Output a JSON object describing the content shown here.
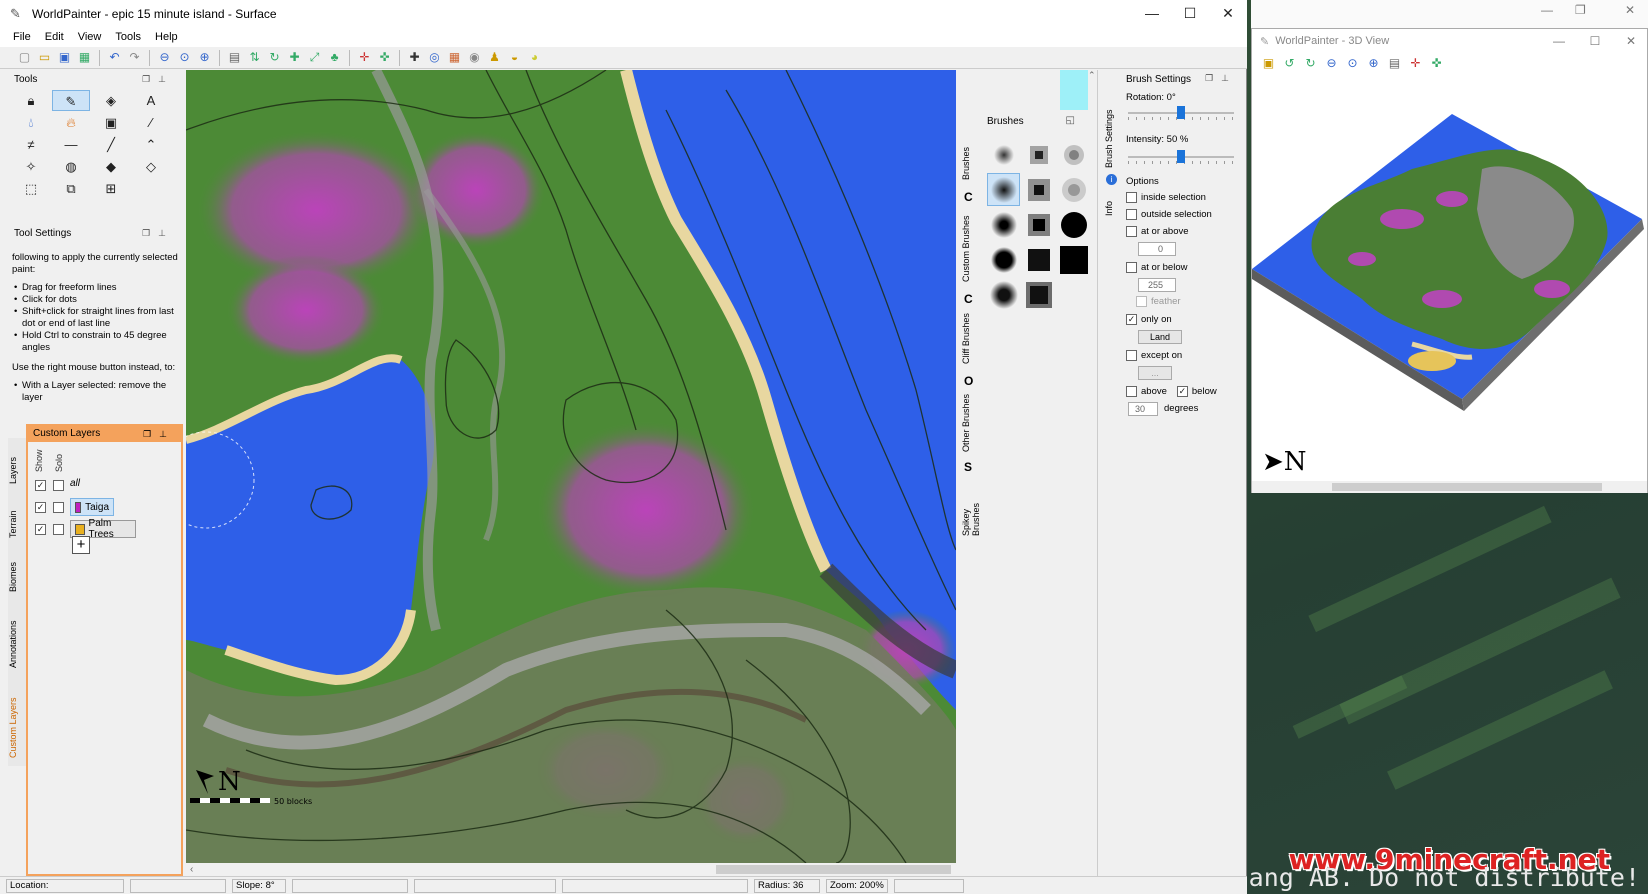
{
  "window": {
    "title": "WorldPainter - epic 15 minute island - Surface",
    "controls": {
      "minimize": "—",
      "maximize": "☐",
      "close": "✕"
    }
  },
  "menu": [
    "File",
    "Edit",
    "View",
    "Tools",
    "Help"
  ],
  "panels": {
    "tools_title": "Tools",
    "tool_settings_title": "Tool Settings",
    "custom_layers_title": "Custom Layers"
  },
  "tool_settings": {
    "intro": "following to apply the currently selected paint:",
    "items": [
      "Drag for freeform lines",
      "Click for dots",
      "Shift+click for straight lines from last dot or end of last line",
      "Hold Ctrl to constrain to 45 degree angles"
    ],
    "right_intro": "Use the right mouse button instead, to:",
    "right_items": [
      "With a Layer selected: remove the layer"
    ]
  },
  "left_tabs": [
    "Layers",
    "Terrain",
    "Biomes",
    "Annotations",
    "Custom Layers"
  ],
  "custom_layers": {
    "col_show": "Show",
    "col_solo": "Solo",
    "all_label": "all",
    "layers": [
      {
        "name": "Taiga",
        "color": "#c020c0",
        "show": true,
        "solo": false,
        "selected": true
      },
      {
        "name": "Palm Trees",
        "color": "#e8b020",
        "show": true,
        "solo": false,
        "selected": false
      }
    ],
    "add_label": "+"
  },
  "brushes": {
    "title": "Brushes",
    "tabs": [
      "Brushes",
      "Custom Brushes",
      "Cliff Brushes",
      "Other Brushes",
      "Spikey Brushes"
    ],
    "tab_letters": [
      "C",
      "C",
      "O",
      "S"
    ]
  },
  "brush_settings": {
    "title": "Brush Settings",
    "side_tabs": [
      "Brush Settings",
      "Info"
    ],
    "rotation_label": "Rotation: 0°",
    "rotation_value": 0.5,
    "intensity_label": "Intensity: 50 %",
    "intensity_value": 0.5,
    "options_label": "Options",
    "inside_selection": "inside selection",
    "outside_selection": "outside selection",
    "at_or_above": "at or above",
    "at_or_above_value": "0",
    "at_or_below": "at or below",
    "at_or_below_value": "255",
    "feather": "feather",
    "only_on": "only on",
    "only_on_value": "Land",
    "except_on": "except on",
    "except_on_value": "...",
    "above": "above",
    "below": "below",
    "degrees_value": "30",
    "degrees_label": "degrees"
  },
  "status": {
    "location": "Location:",
    "slope": "Slope: 8°",
    "radius": "Radius: 36",
    "zoom": "Zoom: 200%"
  },
  "map": {
    "scale_label": "50 blocks",
    "compass": "N"
  },
  "view3d": {
    "title": "WorldPainter - 3D View",
    "compass": "N"
  },
  "overlay": {
    "watermark": "t Mojang AB. Do not distribute!",
    "site": "www.9minecraft.net"
  },
  "colors": {
    "water": "#2e5fe8",
    "grass": "#4c8a36",
    "sand": "#e8d7a0",
    "taiga": "#c040c0",
    "rock": "#9a9a9a",
    "accent": "#f4a25c"
  }
}
